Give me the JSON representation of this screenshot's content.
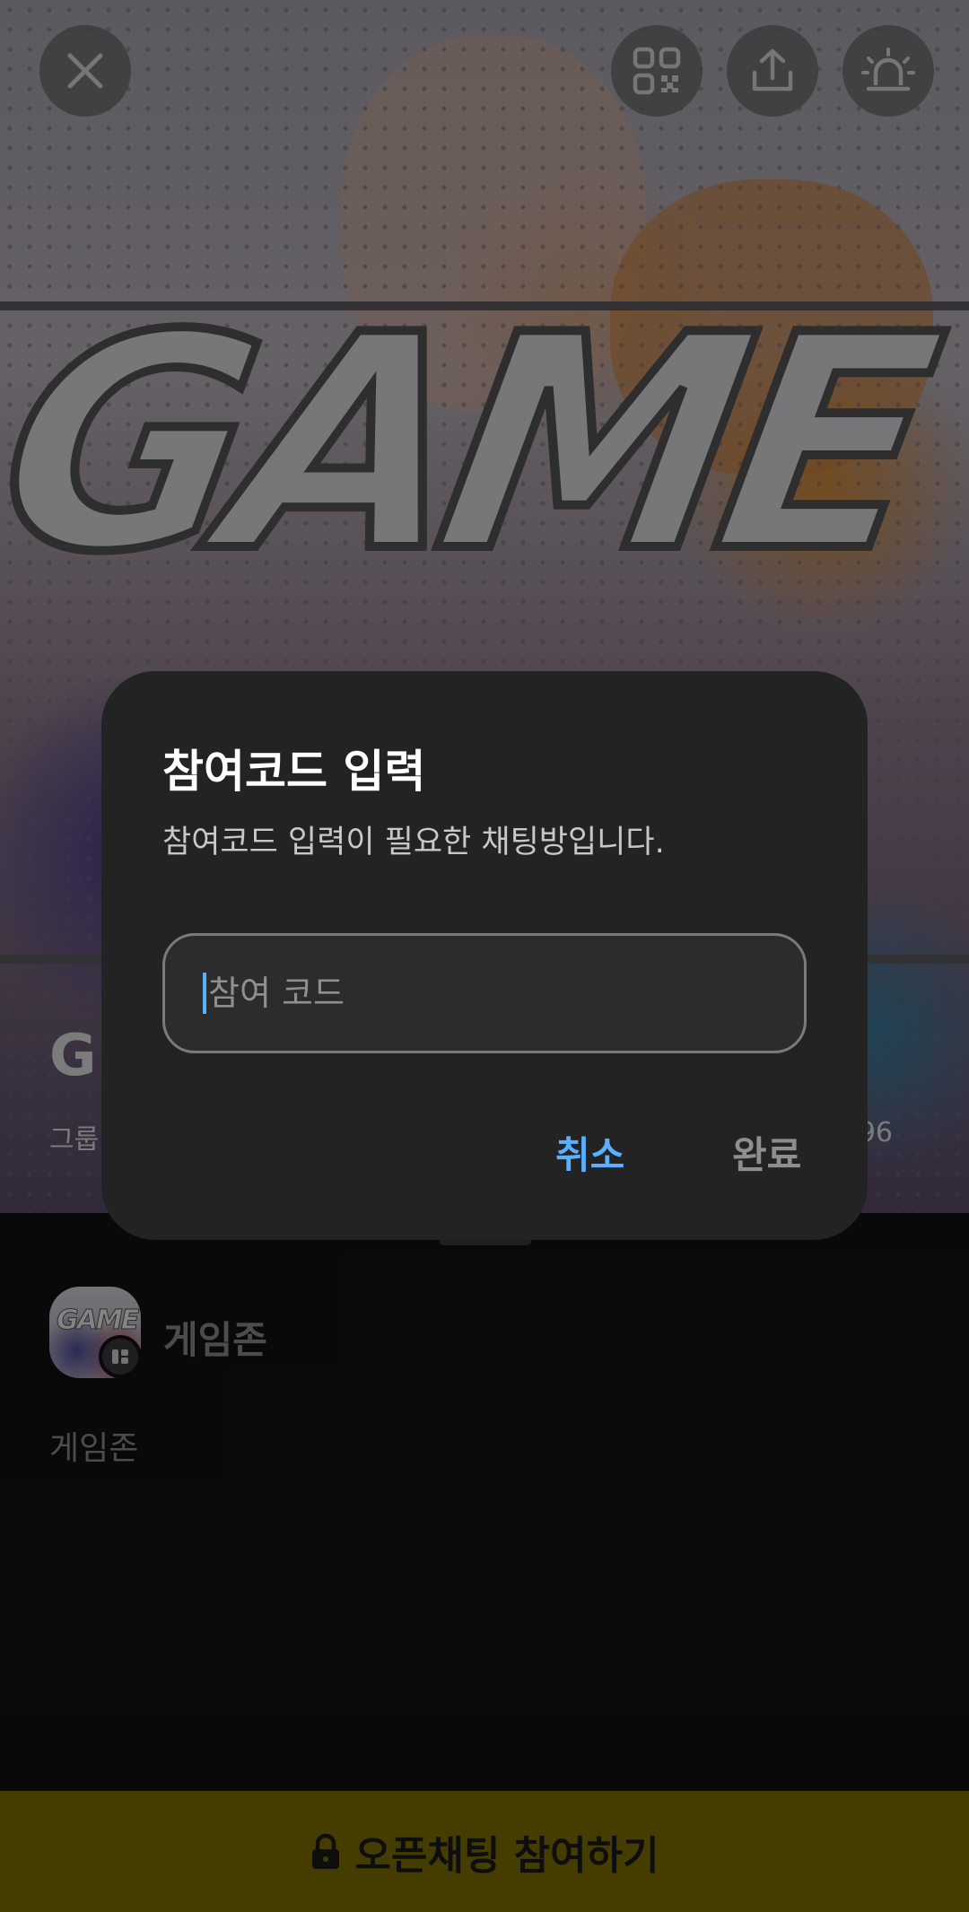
{
  "cover": {
    "title": "G",
    "subtitle_left": "그룹",
    "subtitle_right": "96",
    "banner_word": "GAME"
  },
  "top_buttons": {
    "close": "close-icon",
    "qr": "qr-code-icon",
    "share": "share-icon",
    "report": "siren-icon"
  },
  "room": {
    "avatar_text": "GAME",
    "name": "게임존",
    "description": "게임존"
  },
  "dialog": {
    "title": "참여코드 입력",
    "subtitle": "참여코드 입력이 필요한 채팅방입니다.",
    "input_placeholder": "참여 코드",
    "cancel_label": "취소",
    "done_label": "완료"
  },
  "join_bar": {
    "label": "오픈채팅 참여하기",
    "icon": "lock-icon"
  },
  "colors": {
    "accent_blue": "#5ab0ff",
    "join_bar": "#7e6f00",
    "dialog_bg": "#232323",
    "page_bg": "#121212"
  }
}
